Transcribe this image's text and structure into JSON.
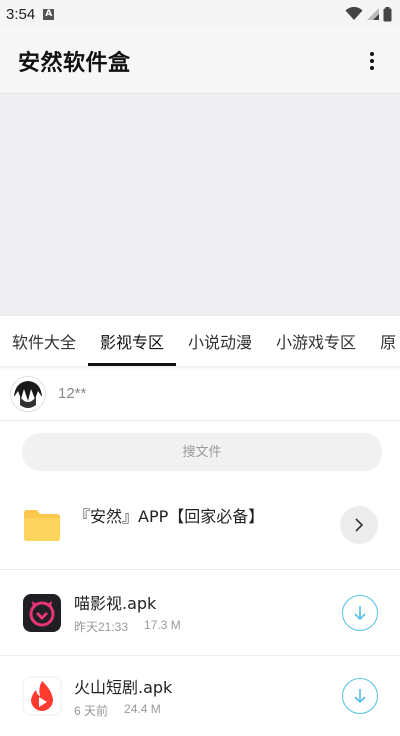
{
  "status_bar": {
    "time": "3:54",
    "notification_badge": "A"
  },
  "app_bar": {
    "title": "安然软件盒"
  },
  "tabs": [
    {
      "label": "软件大全"
    },
    {
      "label": "影视专区"
    },
    {
      "label": "小说动漫"
    },
    {
      "label": "小游戏专区"
    },
    {
      "label": "原"
    }
  ],
  "active_tab_index": 1,
  "user": {
    "name": "12**"
  },
  "search": {
    "placeholder": "搜文件"
  },
  "files": [
    {
      "type": "folder",
      "name": "『安然』APP【回家必备】"
    },
    {
      "type": "apk",
      "name": "喵影视.apk",
      "date": "昨天21:33",
      "size": "17.3 M",
      "icon": "meow-video-app-icon"
    },
    {
      "type": "apk",
      "name": "火山短剧.apk",
      "date": "6 天前",
      "size": "24.4 M",
      "icon": "volcano-drama-app-icon"
    }
  ],
  "colors": {
    "accent_download": "#53c0e8",
    "folder": "#f9c84d",
    "meow_icon": "#e8357a",
    "volcano_icon": "#ff3b2f"
  }
}
